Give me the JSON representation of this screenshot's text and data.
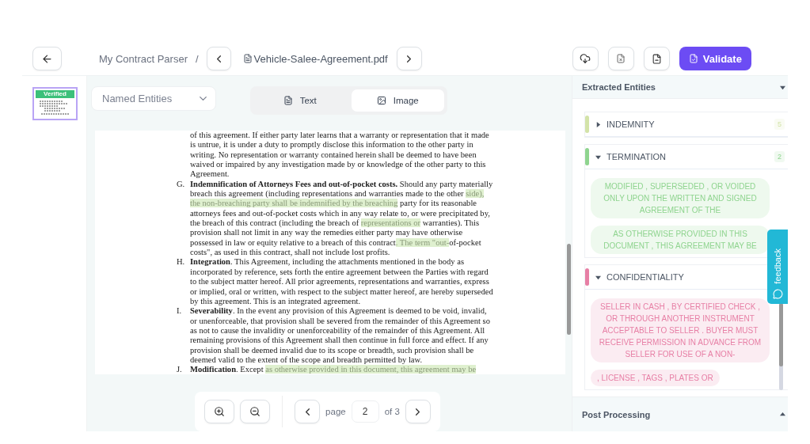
{
  "topbar": {
    "breadcrumb": "My Contract Parser",
    "separator": "/",
    "file_name": "Vehicle-Salee-Agreement.pdf",
    "validate_label": "Validate"
  },
  "thumbnails": [
    {
      "badge": "Verified",
      "selected": true
    }
  ],
  "toolbar": {
    "entity_select": "Named Entities",
    "view_tabs": [
      {
        "label": "Text",
        "kind": "text",
        "selected": false
      },
      {
        "label": "Image",
        "kind": "image",
        "selected": true
      }
    ]
  },
  "document": {
    "clauses": [
      {
        "segments": [
          {
            "kind": "plain",
            "text": "of this agreement. If either party later learns that a warranty or representation that it made is untrue, it is under a duty to promptly disclose this information to the other party in writing. No representation or warranty contained herein shall be deemed to have been waived or impaired by any investigation made by or knowledge of the other party to this Agreement."
          }
        ]
      },
      {
        "letter": "G.",
        "segments": [
          {
            "kind": "bold",
            "text": "Indemnification of Attorneys Fees and out-of-pocket costs."
          },
          {
            "kind": "plain",
            "text": " Should any party materially breach this agreement (including representations and warranties made to the other "
          },
          {
            "kind": "highlight",
            "text": "side), the non-breaching party shall be indemnified by the breaching"
          },
          {
            "kind": "plain",
            "text": " party for its reasonable attorneys fees and out-of-pocket costs which in any way relate to, or were precipitated by, the breach of this contract (including the breach of "
          },
          {
            "kind": "highlight",
            "text": "representations or"
          },
          {
            "kind": "plain",
            "text": " warranties). This provision shall not limit in any way the remedies either party may have otherwise possessed in law or equity relative to a breach of this contract"
          },
          {
            "kind": "highlight",
            "text": ". The term \"out-"
          },
          {
            "kind": "plain",
            "text": "of-pocket costs\", as used in this contract, shall not include lost profits."
          }
        ]
      },
      {
        "letter": "H.",
        "segments": [
          {
            "kind": "bold",
            "text": "Integration"
          },
          {
            "kind": "plain",
            "text": ". This Agreement, including the attachments mentioned in the body as incorporated by reference, sets forth the entire agreement between the Parties with regard to the subject matter hereof. All prior agreements, representations and warranties, express or implied, oral or written, with respect to the subject matter hereof, are hereby superseded by this agreement. This is an integrated agreement."
          }
        ]
      },
      {
        "letter": "I.",
        "segments": [
          {
            "kind": "bold",
            "text": "Severability"
          },
          {
            "kind": "plain",
            "text": ". In the event any provision of this Agreement is deemed to be void, invalid, or unenforceable, that provision shall be severed from the remainder of this Agreement so as not to cause the invalidity or unenforceability of the remainder of this Agreement. All remaining provisions of this Agreement shall then continue in full force and effect. If any provision shall be deemed invalid due to its scope or breadth, such provision shall be deemed valid to the extent of the scope and breadth permitted by law."
          }
        ]
      },
      {
        "letter": "J.",
        "segments": [
          {
            "kind": "bold",
            "text": "Modification"
          },
          {
            "kind": "plain",
            "text": ". Except "
          },
          {
            "kind": "highlight",
            "text": "as otherwise provided in this document, this agreement may be"
          }
        ]
      }
    ]
  },
  "pager": {
    "page_label": "page",
    "page": "2",
    "total": "of 3"
  },
  "entities": {
    "title": "Extracted Entities",
    "groups": [
      {
        "label": "INDEMNITY",
        "color": "#d3e3a8",
        "expanded": false,
        "count": "5"
      },
      {
        "label": "TERMINATION",
        "color": "#8fd48f",
        "expanded": true,
        "count": "2",
        "chips": [
          "MODIFIED , SUPERSEDED , OR VOIDED ONLY UPON THE WRITTEN AND SIGNED AGREEMENT OF THE",
          "AS OTHERWISE PROVIDED IN THIS DOCUMENT , THIS AGREEMENT MAY BE"
        ]
      },
      {
        "label": "CONFIDENTIALITY",
        "color": "#e77fa5",
        "expanded": true,
        "chips": [
          "SELLER IN CASH , BY CERTIFIED CHECK , OR THROUGH ANOTHER INSTRUMENT ACCEPTABLE TO SELLER . BUYER MUST RECEIVE PERMISSION IN ADVANCE FROM SELLER FOR USE OF A NON-",
          ", LICENSE , TAGS , PLATES OR"
        ]
      }
    ]
  },
  "post_processing": {
    "title": "Post Processing"
  },
  "feedback": {
    "label": "feedback"
  }
}
